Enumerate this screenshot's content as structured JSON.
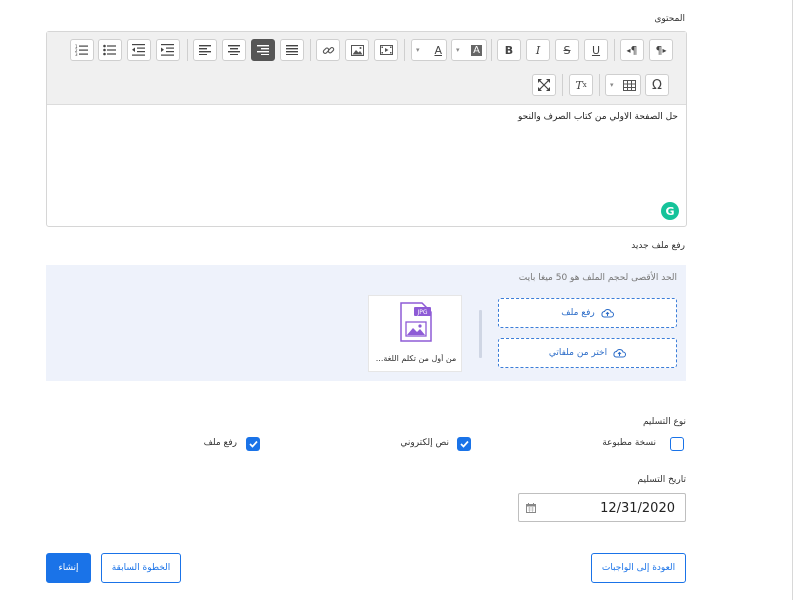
{
  "content_section": {
    "label": "المحتوى",
    "editor_text": "حل الصفحة الاولي من كتاب الصرف والنحو"
  },
  "toolbar": {
    "row1": [
      {
        "icon": "numbered-list-icon",
        "glyph": "1≡"
      },
      {
        "icon": "bulleted-list-icon",
        "glyph": "•≡"
      },
      {
        "icon": "outdent-icon",
        "glyph": "⇤"
      },
      {
        "icon": "indent-icon",
        "glyph": "⇥"
      },
      {
        "icon": "align-left-icon",
        "glyph": "≡"
      },
      {
        "icon": "align-center-icon",
        "glyph": "≡"
      },
      {
        "icon": "align-right-icon",
        "glyph": "≡"
      },
      {
        "icon": "align-justify-icon",
        "glyph": "≡"
      },
      {
        "icon": "link-icon",
        "glyph": "🔗"
      },
      {
        "icon": "image-icon",
        "glyph": "▣"
      },
      {
        "icon": "media-icon",
        "glyph": "▤"
      },
      {
        "icon": "text-color-icon",
        "glyph": "A"
      },
      {
        "icon": "bg-color-icon",
        "glyph": "A"
      },
      {
        "icon": "bold-icon",
        "glyph": "B"
      },
      {
        "icon": "italic-icon",
        "glyph": "I"
      },
      {
        "icon": "strikethrough-icon",
        "glyph": "S"
      },
      {
        "icon": "underline-icon",
        "glyph": "U"
      },
      {
        "icon": "ltr-paragraph-icon",
        "glyph": "¶"
      },
      {
        "icon": "rtl-paragraph-icon",
        "glyph": "¶"
      }
    ],
    "row2": [
      {
        "icon": "fullscreen-icon",
        "glyph": "⤢"
      },
      {
        "icon": "clear-format-icon",
        "glyph": "Tx"
      },
      {
        "icon": "table-icon",
        "glyph": "⊞"
      },
      {
        "icon": "special-char-icon",
        "glyph": "Ω"
      }
    ]
  },
  "upload": {
    "label": "رفع ملف جديد",
    "hint": "الحد الأقصى لحجم الملف هو 50 ميغا بايت",
    "upload_file_label": "رفع ملف",
    "choose_from_my_files_label": "اختر من ملفاتي",
    "file": {
      "type_badge": "JPG",
      "name": "من أول من تكلم اللغة..."
    }
  },
  "delivery_type": {
    "label": "نوع التسليم",
    "options": [
      {
        "label": "نسخة مطبوعة",
        "checked": false
      },
      {
        "label": "نص إلكتروني",
        "checked": true
      },
      {
        "label": "رفع ملف",
        "checked": true
      }
    ]
  },
  "delivery_date": {
    "label": "تاريخ التسليم",
    "value": "12/31/2020"
  },
  "buttons": {
    "create": "إنشاء",
    "previous_step": "الخطوة السابقة",
    "back_to_homework": "العودة إلى الواجبات"
  },
  "colors": {
    "accent": "#1a73e8",
    "grammarly": "#15c39a",
    "upload_bg": "#eef2fb"
  }
}
